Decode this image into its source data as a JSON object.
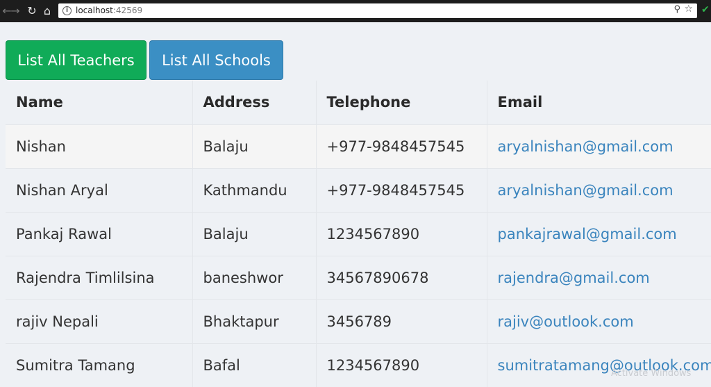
{
  "browser": {
    "url_host": "localhost",
    "url_port": ":42569",
    "icons": [
      "back-arrow-icon",
      "forward-arrow-icon",
      "reload-icon",
      "home-icon",
      "info-icon",
      "zoom-icon",
      "star-icon",
      "check-icon"
    ]
  },
  "toolbar": {
    "teachers_label": "List All Teachers",
    "schools_label": "List All Schools",
    "teachers_color": "#10ab58",
    "schools_color": "#3b8fc4"
  },
  "table": {
    "headers": [
      "Name",
      "Address",
      "Telephone",
      "Email"
    ],
    "rows": [
      {
        "name": "Nishan",
        "address": "Balaju",
        "telephone": "+977-9848457545",
        "email": "aryalnishan@gmail.com"
      },
      {
        "name": "Nishan Aryal",
        "address": "Kathmandu",
        "telephone": "+977-9848457545",
        "email": "aryalnishan@gmail.com"
      },
      {
        "name": "Pankaj Rawal",
        "address": "Balaju",
        "telephone": "1234567890",
        "email": "pankajrawal@gmail.com"
      },
      {
        "name": "Rajendra Timlilsina",
        "address": "baneshwor",
        "telephone": "34567890678",
        "email": "rajendra@gmail.com"
      },
      {
        "name": "rajiv Nepali",
        "address": "Bhaktapur",
        "telephone": "3456789",
        "email": "rajiv@outlook.com"
      },
      {
        "name": "Sumitra Tamang",
        "address": "Bafal",
        "telephone": "1234567890",
        "email": "sumitratamang@outlook.com"
      }
    ],
    "email_color": "#3a84bd"
  },
  "watermark": "Activate Windows"
}
